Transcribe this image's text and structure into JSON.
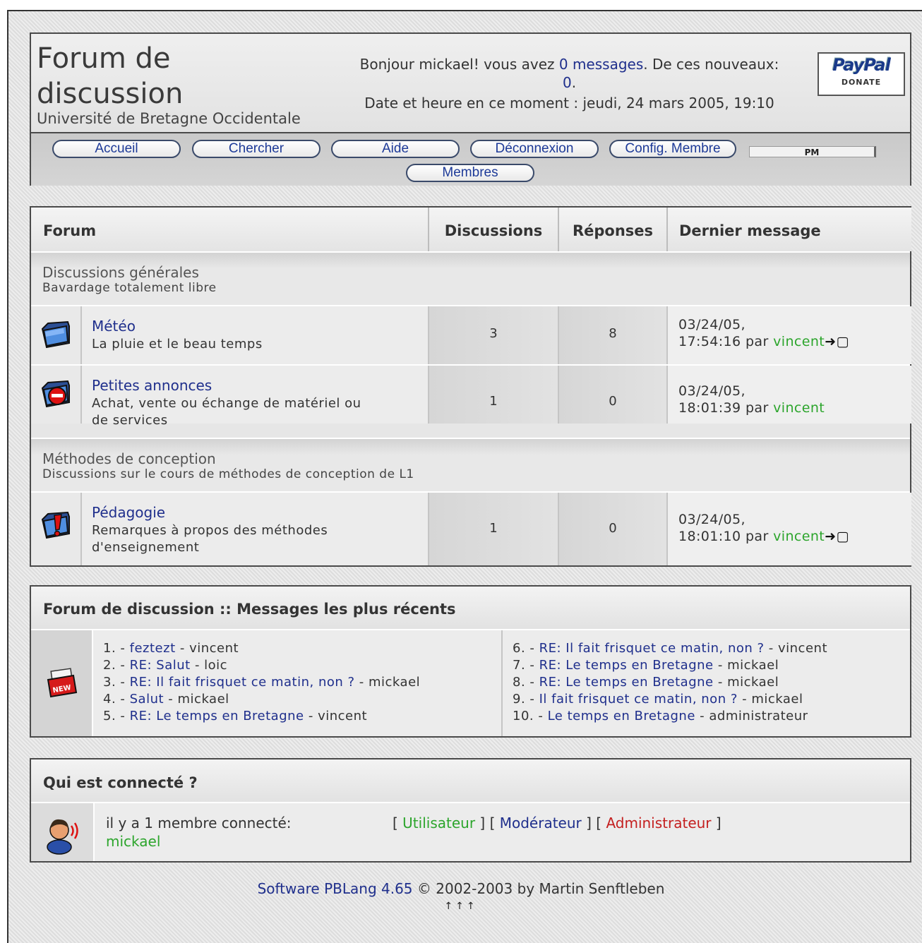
{
  "header": {
    "title_line1": "Forum de",
    "title_line2": "discussion",
    "subtitle": "Université de Bretagne Occidentale",
    "welcome_prefix": "Bonjour mickael! vous avez ",
    "welcome_link": "0 messages",
    "welcome_mid": ". De ces nouveaux: ",
    "welcome_new": "0",
    "welcome_end": ".",
    "datetime": "Date et heure en ce moment : jeudi, 24 mars 2005, 19:10",
    "paypal_logo": "PayPal",
    "paypal_label": "DONATE"
  },
  "nav": {
    "items": [
      "Accueil",
      "Chercher",
      "Aide",
      "Déconnexion",
      "Config. Membre",
      "Membres"
    ],
    "pm_label": "PM"
  },
  "forums": {
    "columns": [
      "Forum",
      "Discussions",
      "Réponses",
      "Dernier message"
    ],
    "categories": [
      {
        "name": "Discussions générales",
        "desc": "Bavardage totalement libre"
      },
      {
        "name": "Méthodes de conception",
        "desc": "Discussions sur le cours de méthodes de conception de L1"
      }
    ],
    "rows": [
      {
        "name": "Météo",
        "desc": "La pluie et le beau temps",
        "discussions": "3",
        "replies": "8",
        "last_date": "03/24/05,",
        "last_time": "17:54:16 par ",
        "last_user": "vincent",
        "icon": "folder-icon"
      },
      {
        "name": "Petites annonces",
        "desc_l1": "Achat, vente ou échange de matériel ou",
        "desc_l2": "de services",
        "discussions": "1",
        "replies": "0",
        "last_date": "03/24/05,",
        "last_time": "18:01:39 par ",
        "last_user": "vincent",
        "icon": "locked-folder-icon"
      },
      {
        "name": "Pédagogie",
        "desc_l1": "Remarques à propos des méthodes",
        "desc_l2": "d'enseignement",
        "discussions": "1",
        "replies": "0",
        "last_date": "03/24/05,",
        "last_time": "18:01:10 par ",
        "last_user": "vincent",
        "icon": "alert-folder-icon"
      }
    ]
  },
  "recent": {
    "title": "Forum de discussion :: Messages les plus récents",
    "icon": "new-message-icon",
    "items": [
      {
        "n": "1. - ",
        "title": "feztezt",
        "author": "vincent"
      },
      {
        "n": "2. - ",
        "title": "RE: Salut",
        "author": "loic"
      },
      {
        "n": "3. - ",
        "title": "RE: Il fait frisquet ce matin, non ?",
        "author": "mickael"
      },
      {
        "n": "4. - ",
        "title": "Salut",
        "author": "mickael"
      },
      {
        "n": "5. - ",
        "title": "RE: Le temps en Bretagne",
        "author": "vincent"
      },
      {
        "n": "6. - ",
        "title": "RE: Il fait frisquet ce matin, non ?",
        "author": "vincent"
      },
      {
        "n": "7. - ",
        "title": "RE: Le temps en Bretagne",
        "author": "mickael"
      },
      {
        "n": "8. - ",
        "title": "RE: Le temps en Bretagne",
        "author": "mickael"
      },
      {
        "n": "9. - ",
        "title": "Il fait frisquet ce matin, non ?",
        "author": "mickael"
      },
      {
        "n": "10. - ",
        "title": "Le temps en Bretagne",
        "author": "administrateur"
      }
    ]
  },
  "online": {
    "title": "Qui est connecté ?",
    "count_text": "il y a 1 membre connecté:",
    "user": "mickael",
    "legend_user": "Utilisateur",
    "legend_mod": "Modérateur",
    "legend_admin": "Administrateur"
  },
  "footer": {
    "link": "Software PBLang 4.65",
    "text": " © 2002-2003 by Martin Senftleben",
    "arrows": "↑↑↑"
  },
  "colors": {
    "link": "#1f2f8c",
    "user": "#2ca52c",
    "admin": "#c42020"
  }
}
